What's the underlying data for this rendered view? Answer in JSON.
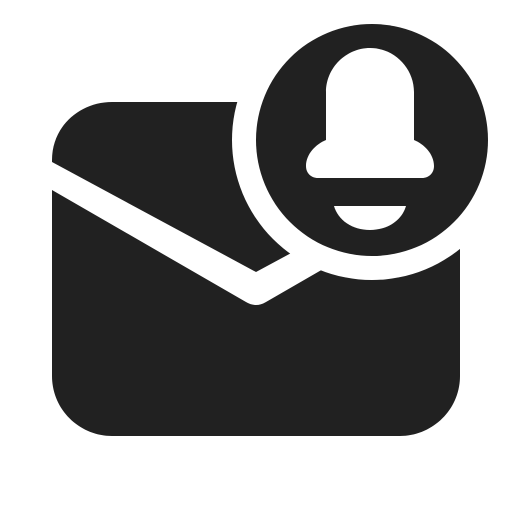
{
  "icon": {
    "name": "mail-alert-icon",
    "parts": [
      "envelope-icon",
      "bell-icon"
    ],
    "colors": {
      "fill": "#212121",
      "background": "#ffffff"
    }
  }
}
